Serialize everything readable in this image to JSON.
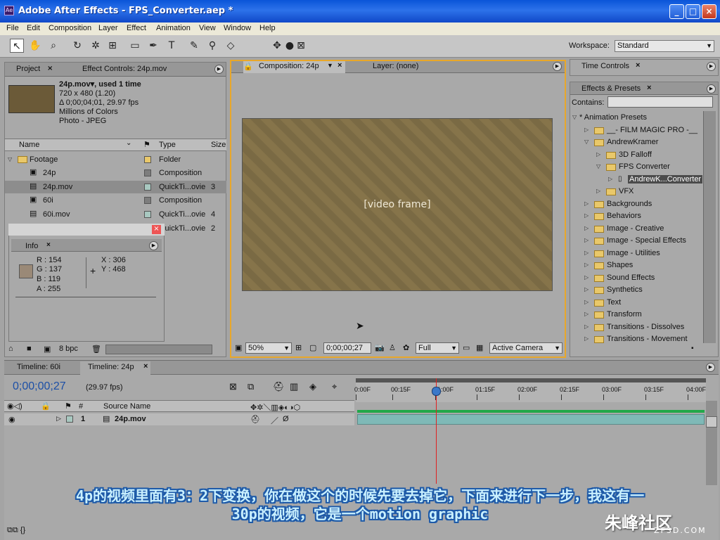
{
  "window": {
    "title": "Adobe After Effects - FPS_Converter.aep *",
    "buttons": [
      "_",
      "□",
      "×"
    ]
  },
  "menu": [
    "File",
    "Edit",
    "Composition",
    "Layer",
    "Effect",
    "Animation",
    "View",
    "Window",
    "Help"
  ],
  "workspace": {
    "label": "Workspace:",
    "value": "Standard"
  },
  "project": {
    "tabs": [
      "Project",
      "Effect Controls: 24p.mov"
    ],
    "selected_item": {
      "name": "24p.mov▾, used 1 time",
      "dims": "720 x 480 (1.20)",
      "duration": "Δ 0;00;04;01, 29.97 fps",
      "colors": "Millions of Colors",
      "codec": "Photo - JPEG"
    },
    "columns": [
      "Name",
      "Type",
      "Size"
    ],
    "items": [
      {
        "name": "Footage",
        "type": "Folder",
        "color": "#e9c86a"
      },
      {
        "name": "24p",
        "type": "Composition",
        "color": "#7d7d7d"
      },
      {
        "name": "24p.mov",
        "type": "QuickTi...ovie",
        "size": "3",
        "color": "#a8c8c0"
      },
      {
        "name": "60i",
        "type": "Composition",
        "color": "#7d7d7d"
      },
      {
        "name": "60i.mov",
        "type": "QuickTi...ovie",
        "size": "4",
        "color": "#a8c8c0"
      },
      {
        "name": "",
        "type": "QuickTi...ovie",
        "size": "2",
        "color": "#a8c8c0"
      }
    ],
    "bpc": "8 bpc"
  },
  "info": {
    "tab": "Info",
    "rgb": [
      "R : 154",
      "G : 137",
      "B : 119",
      "A : 255"
    ],
    "xy": [
      "X : 306",
      "Y : 468"
    ],
    "swatch": "#9a8977"
  },
  "composition": {
    "tabs": [
      "Composition: 24p",
      "Layer: (none)"
    ],
    "zoom": "50%",
    "timecode": "0;00;00;27",
    "resolution": "Full",
    "camera": "Active Camera"
  },
  "time_controls": {
    "tab": "Time Controls"
  },
  "effects": {
    "tab": "Effects & Presets",
    "contains_label": "Contains:",
    "tree": [
      {
        "label": "* Animation Presets",
        "depth": 0,
        "open": true,
        "kind": "root"
      },
      {
        "label": "__- FILM MAGIC PRO -__",
        "depth": 1,
        "kind": "folder"
      },
      {
        "label": "AndrewKramer",
        "depth": 1,
        "open": true,
        "kind": "folder"
      },
      {
        "label": "3D Falloff",
        "depth": 2,
        "kind": "folder"
      },
      {
        "label": "FPS Converter",
        "depth": 2,
        "open": true,
        "kind": "folder"
      },
      {
        "label": "AndrewK...Converter",
        "depth": 3,
        "kind": "preset",
        "selected": true
      },
      {
        "label": "VFX",
        "depth": 2,
        "kind": "folder"
      },
      {
        "label": "Backgrounds",
        "depth": 1,
        "kind": "folder"
      },
      {
        "label": "Behaviors",
        "depth": 1,
        "kind": "folder"
      },
      {
        "label": "Image - Creative",
        "depth": 1,
        "kind": "folder"
      },
      {
        "label": "Image - Special Effects",
        "depth": 1,
        "kind": "folder"
      },
      {
        "label": "Image - Utilities",
        "depth": 1,
        "kind": "folder"
      },
      {
        "label": "Shapes",
        "depth": 1,
        "kind": "folder"
      },
      {
        "label": "Sound Effects",
        "depth": 1,
        "kind": "folder"
      },
      {
        "label": "Synthetics",
        "depth": 1,
        "kind": "folder"
      },
      {
        "label": "Text",
        "depth": 1,
        "kind": "folder"
      },
      {
        "label": "Transform",
        "depth": 1,
        "kind": "folder"
      },
      {
        "label": "Transitions - Dissolves",
        "depth": 1,
        "kind": "folder"
      },
      {
        "label": "Transitions - Movement",
        "depth": 1,
        "kind": "folder"
      }
    ]
  },
  "timeline": {
    "tabs": [
      "Timeline: 60i",
      "Timeline: 24p"
    ],
    "current_time": "0;00;00;27",
    "fps": "(29.97 fps)",
    "columns": [
      "#",
      "Source Name"
    ],
    "ruler": [
      "0:00F",
      "00:15F",
      "01:00F",
      "01:15F",
      "02:00F",
      "02:15F",
      "03:00F",
      "03:15F",
      "04:00F"
    ],
    "layers": [
      {
        "index": "1",
        "name": "24p.mov"
      }
    ]
  },
  "subtitle": {
    "line1": "4p的视频里面有3：2下变换，你在做这个的时候先要去掉它，下面来进行下一步，我这有一",
    "line2": "30p的视频，它是一个motion graphic"
  },
  "watermark": {
    "main": "朱峰社区",
    "sub": "ZF3D.COM"
  }
}
